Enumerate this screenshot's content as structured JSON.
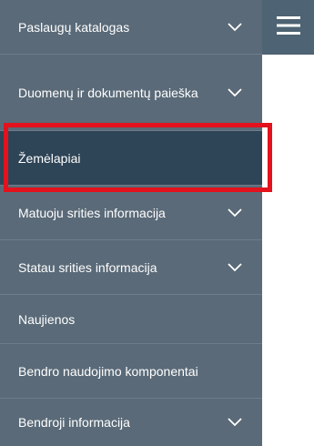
{
  "menu": {
    "items": [
      {
        "label": "Paslaugų katalogas",
        "has_chevron": true
      },
      {
        "label": "Duomenų ir dokumentų paieška",
        "has_chevron": true
      },
      {
        "label": "Žemėlapiai",
        "has_chevron": false,
        "active": true
      },
      {
        "label": "Matuoju srities informacija",
        "has_chevron": true
      },
      {
        "label": "Statau srities informacija",
        "has_chevron": true
      },
      {
        "label": "Naujienos",
        "has_chevron": false
      },
      {
        "label": "Bendro naudojimo komponentai",
        "has_chevron": false
      },
      {
        "label": "Bendroji informacija",
        "has_chevron": true
      }
    ]
  },
  "hamburger": {
    "icon": "hamburger-menu-icon"
  },
  "highlight": {
    "color": "#e3121c"
  },
  "colors": {
    "menu_bg": "#5a6a78",
    "active_bg": "#2e4457",
    "text": "#ffffff"
  }
}
